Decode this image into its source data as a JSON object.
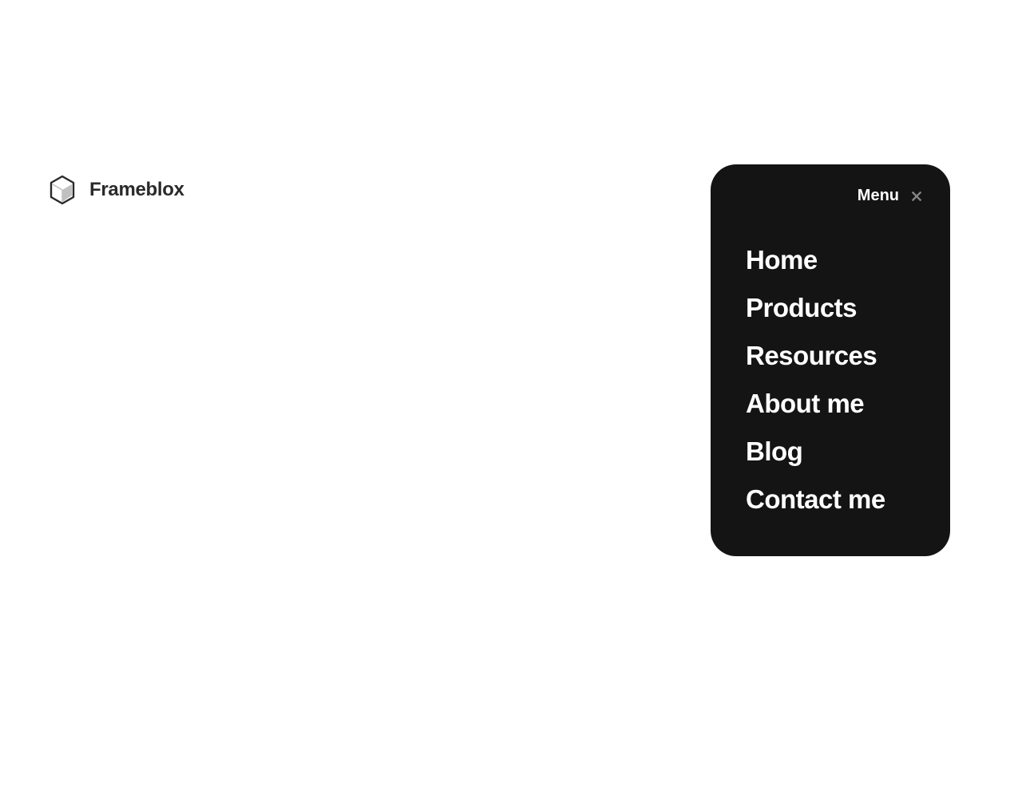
{
  "brand": {
    "name": "Frameblox"
  },
  "menu": {
    "label": "Menu",
    "items": [
      {
        "label": "Home"
      },
      {
        "label": "Products"
      },
      {
        "label": "Resources"
      },
      {
        "label": "About me"
      },
      {
        "label": "Blog"
      },
      {
        "label": "Contact me"
      }
    ]
  }
}
